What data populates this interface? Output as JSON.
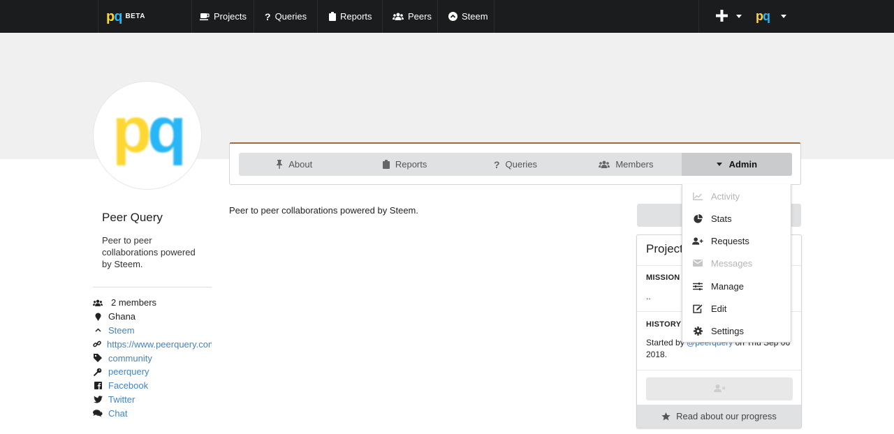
{
  "nav": {
    "brand_p": "p",
    "brand_q": "q",
    "beta": "BETA",
    "items": [
      {
        "label": "Projects",
        "icon": "coffee-icon"
      },
      {
        "label": "Queries",
        "icon": "question-icon"
      },
      {
        "label": "Reports",
        "icon": "clipboard-icon"
      },
      {
        "label": "Peers",
        "icon": "users-icon"
      },
      {
        "label": "Steem",
        "icon": "steem-icon"
      }
    ],
    "add_icon": "plus-icon",
    "user_logo_p": "p",
    "user_logo_q": "q"
  },
  "avatar": {
    "p": "p",
    "q": "q"
  },
  "project": {
    "title": "Peer Query",
    "description": "Peer to peer collaborations powered by Steem.",
    "meta": [
      {
        "icon": "users-icon",
        "text": "2 members",
        "link": false
      },
      {
        "icon": "map-marker-icon",
        "text": "Ghana",
        "link": false
      },
      {
        "icon": "chevron-up-icon",
        "text": "Steem",
        "link": true
      },
      {
        "icon": "link-icon",
        "text": "https://www.peerquery.com",
        "link": true
      },
      {
        "icon": "tag-icon",
        "text": "community",
        "link": true
      },
      {
        "icon": "key-icon",
        "text": "peerquery",
        "link": true
      },
      {
        "icon": "facebook-icon",
        "text": "Facebook",
        "link": true
      },
      {
        "icon": "twitter-icon",
        "text": "Twitter",
        "link": true
      },
      {
        "icon": "comments-icon",
        "text": "Chat",
        "link": true
      }
    ]
  },
  "tabs": [
    {
      "label": "About",
      "icon": "pin-icon"
    },
    {
      "label": "Reports",
      "icon": "clipboard-icon"
    },
    {
      "label": "Queries",
      "icon": "question-icon"
    },
    {
      "label": "Members",
      "icon": "users-icon"
    },
    {
      "label": "Admin",
      "icon": "caret-down-icon"
    }
  ],
  "main": {
    "description": "Peer to peer collaborations powered by Steem."
  },
  "card": {
    "header": "Project",
    "mission_label": "MISSION",
    "mission_text": "..",
    "history_label": "HISTORY",
    "history_prefix": "Started by",
    "history_user": "@peerquery",
    "history_suffix": "on Thu Sep 06",
    "history_year": "2018.",
    "join_icon": "user-times-icon",
    "footer_label": "Read about our progress",
    "footer_icon": "star-icon"
  },
  "admin_menu": [
    {
      "label": "Activity",
      "icon": "chart-line-icon",
      "disabled": true
    },
    {
      "label": "Stats",
      "icon": "chart-pie-icon",
      "disabled": false
    },
    {
      "label": "Requests",
      "icon": "user-plus-icon",
      "disabled": false
    },
    {
      "label": "Messages",
      "icon": "envelope-icon",
      "disabled": true
    },
    {
      "label": "Manage",
      "icon": "sliders-icon",
      "disabled": false
    },
    {
      "label": "Edit",
      "icon": "edit-icon",
      "disabled": false
    },
    {
      "label": "Settings",
      "icon": "cog-icon",
      "disabled": false
    }
  ],
  "colors": {
    "nav_bg": "#1b1c1d",
    "accent_border": "#a5673f",
    "link": "#4183c4",
    "logo_yellow": "#fdd835",
    "logo_blue": "#29b6f6"
  }
}
